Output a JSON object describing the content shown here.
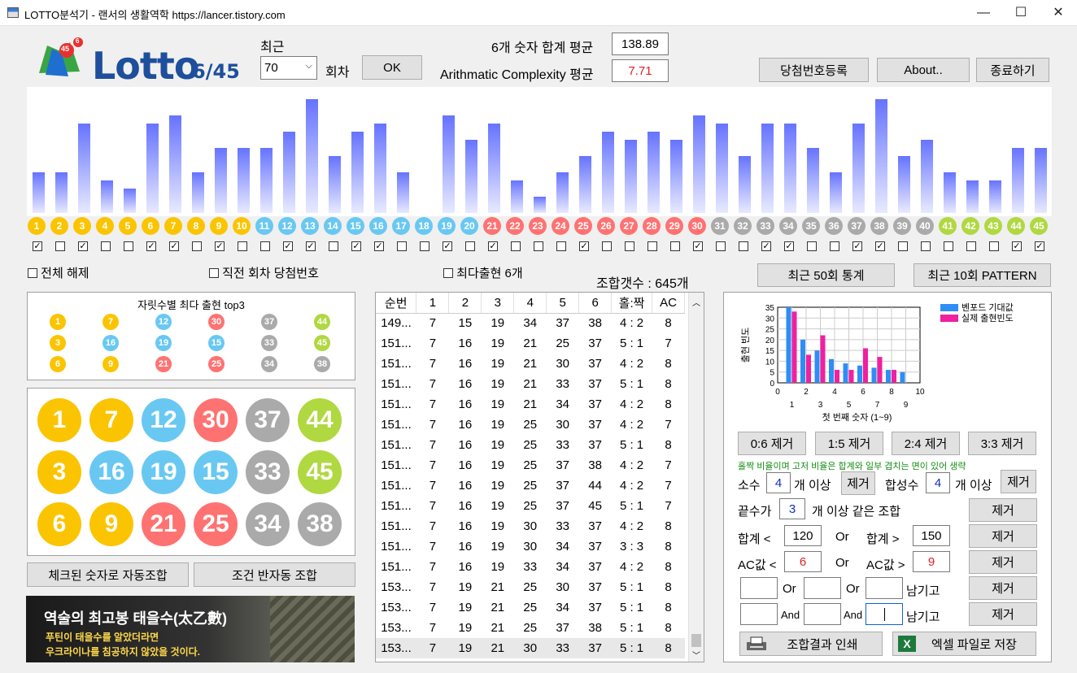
{
  "window": {
    "title": "LOTTO분석기  -  랜서의 생활역학 https://lancer.tistory.com",
    "minimize": "—",
    "maximize": "☐",
    "close": "✕"
  },
  "logo": {
    "text": "Lotto",
    "sub": "6/45",
    "badge": "45",
    "badge2": "6"
  },
  "top": {
    "recent_label": "최근",
    "recent_value": "70",
    "round_label": "회차",
    "ok_label": "OK",
    "sum_avg_label": "6개 숫자 합계 평균",
    "sum_avg_value": "138.89",
    "ac_avg_label": "Arithmatic Complexity 평균",
    "ac_avg_value": "7.71",
    "register_label": "당첨번호등록",
    "about_label": "About..",
    "exit_label": "종료하기"
  },
  "colors": {
    "yellow": "#fbc400",
    "blue": "#69c8f2",
    "red": "#ff7272",
    "gray": "#aaaaaa",
    "green": "#b0d840",
    "bar": "#6673ff"
  },
  "bars": [
    5,
    5,
    11,
    4,
    3,
    11,
    12,
    5,
    8,
    8,
    8,
    10,
    14,
    7,
    10,
    11,
    5,
    0,
    12,
    9,
    11,
    4,
    2,
    5,
    7,
    10,
    9,
    10,
    9,
    12,
    11,
    7,
    11,
    11,
    8,
    5,
    11,
    14,
    7,
    9,
    5,
    4,
    4,
    8,
    8
  ],
  "checks": [
    1,
    0,
    1,
    0,
    0,
    1,
    1,
    0,
    1,
    0,
    0,
    1,
    1,
    0,
    1,
    1,
    0,
    0,
    1,
    0,
    1,
    0,
    0,
    0,
    1,
    0,
    0,
    0,
    0,
    1,
    0,
    0,
    1,
    1,
    0,
    0,
    1,
    1,
    0,
    0,
    0,
    0,
    0,
    1,
    1
  ],
  "options": {
    "clear_all": "전체 해제",
    "last_round": "직전 회차 당첨번호",
    "most_six": "최다출현 6개",
    "combo_count": "조합갯수 : 645개"
  },
  "stat_buttons": {
    "recent50": "최근 50회 통계",
    "recent10": "최근 10회 PATTERN"
  },
  "top3": {
    "title": "자릿수별 최다 출현 top3",
    "rows": [
      [
        1,
        7,
        12,
        30,
        37,
        44
      ],
      [
        3,
        16,
        19,
        15,
        33,
        45
      ],
      [
        6,
        9,
        21,
        25,
        34,
        38
      ]
    ]
  },
  "big": {
    "rows": [
      [
        1,
        7,
        12,
        30,
        37,
        44
      ],
      [
        3,
        16,
        19,
        15,
        33,
        45
      ],
      [
        6,
        9,
        21,
        25,
        34,
        38
      ]
    ]
  },
  "actions": {
    "auto": "체크된 숫자로 자동조합",
    "semi": "조건 반자동 조합"
  },
  "banner": {
    "title": "역술의 최고봉 태을수(太乙數)",
    "line1": "푸틴이 태을수를 알았더라면",
    "line2": "우크라이나를 침공하지 않았을 것이다."
  },
  "table": {
    "headers": [
      "순번",
      "1",
      "2",
      "3",
      "4",
      "5",
      "6",
      "홀:짝",
      "AC"
    ],
    "rows": [
      [
        "149...",
        "7",
        "15",
        "19",
        "34",
        "37",
        "38",
        "4 : 2",
        "8"
      ],
      [
        "151...",
        "7",
        "16",
        "19",
        "21",
        "25",
        "37",
        "5 : 1",
        "7"
      ],
      [
        "151...",
        "7",
        "16",
        "19",
        "21",
        "30",
        "37",
        "4 : 2",
        "8"
      ],
      [
        "151...",
        "7",
        "16",
        "19",
        "21",
        "33",
        "37",
        "5 : 1",
        "8"
      ],
      [
        "151...",
        "7",
        "16",
        "19",
        "21",
        "34",
        "37",
        "4 : 2",
        "8"
      ],
      [
        "151...",
        "7",
        "16",
        "19",
        "25",
        "30",
        "37",
        "4 : 2",
        "7"
      ],
      [
        "151...",
        "7",
        "16",
        "19",
        "25",
        "33",
        "37",
        "5 : 1",
        "8"
      ],
      [
        "151...",
        "7",
        "16",
        "19",
        "25",
        "37",
        "38",
        "4 : 2",
        "7"
      ],
      [
        "151...",
        "7",
        "16",
        "19",
        "25",
        "37",
        "44",
        "4 : 2",
        "7"
      ],
      [
        "151...",
        "7",
        "16",
        "19",
        "25",
        "37",
        "45",
        "5 : 1",
        "7"
      ],
      [
        "151...",
        "7",
        "16",
        "19",
        "30",
        "33",
        "37",
        "4 : 2",
        "8"
      ],
      [
        "151...",
        "7",
        "16",
        "19",
        "30",
        "34",
        "37",
        "3 : 3",
        "8"
      ],
      [
        "151...",
        "7",
        "16",
        "19",
        "33",
        "34",
        "37",
        "4 : 2",
        "8"
      ],
      [
        "153...",
        "7",
        "19",
        "21",
        "25",
        "30",
        "37",
        "5 : 1",
        "8"
      ],
      [
        "153...",
        "7",
        "19",
        "21",
        "25",
        "34",
        "37",
        "5 : 1",
        "8"
      ],
      [
        "153...",
        "7",
        "19",
        "21",
        "25",
        "37",
        "38",
        "5 : 1",
        "8"
      ],
      [
        "153...",
        "7",
        "19",
        "21",
        "30",
        "33",
        "37",
        "5 : 1",
        "8"
      ]
    ]
  },
  "chart_data": {
    "type": "bar",
    "ylabel": "출현 빈도",
    "xlabel": "첫 번째 숫자 (1~9)",
    "x": [
      1,
      2,
      3,
      4,
      5,
      6,
      7,
      8,
      9
    ],
    "xlim": [
      0,
      10
    ],
    "ylim": [
      0,
      35
    ],
    "xticks": [
      "0",
      "2",
      "4",
      "6",
      "8",
      "10"
    ],
    "xticks_odd": [
      "1",
      "3",
      "5",
      "7",
      "9"
    ],
    "yticks": [
      "0",
      "5",
      "10",
      "15",
      "20",
      "25",
      "30",
      "35"
    ],
    "series": [
      {
        "name": "벤포드 기대값",
        "color": "#2f8df6",
        "values": [
          35,
          20,
          15,
          11,
          9,
          8,
          7,
          6,
          5
        ]
      },
      {
        "name": "실제 출현빈도",
        "color": "#f020a0",
        "values": [
          33,
          13,
          22,
          6,
          6,
          16,
          12,
          6,
          0
        ]
      }
    ]
  },
  "filters": {
    "r06": "0:6 제거",
    "r15": "1:5 제거",
    "r24": "2:4 제거",
    "r33": "3:3 제거",
    "note": "홀짝 비율이며 고저 비율은 합계와 일부 겹치는 면이 있어 생략",
    "prime_label": "소수",
    "prime_value": "4",
    "prime_suffix": "개 이상",
    "remove": "제거",
    "composite_label": "합성수",
    "composite_value": "4",
    "composite_suffix": "개 이상",
    "ending_label": "끝수가",
    "ending_value": "3",
    "ending_suffix": "개 이상 같은 조합",
    "sum_lt_label": "합계 <",
    "sum_lt_value": "120",
    "or": "Or",
    "sum_gt_label": "합계 >",
    "sum_gt_value": "150",
    "ac_lt_label": "AC값 <",
    "ac_lt_value": "6",
    "ac_gt_label": "AC값 >",
    "ac_gt_value": "9",
    "and": "And",
    "keep": "남기고",
    "print": "조합결과 인쇄",
    "excel": "엑셀 파일로 저장"
  }
}
